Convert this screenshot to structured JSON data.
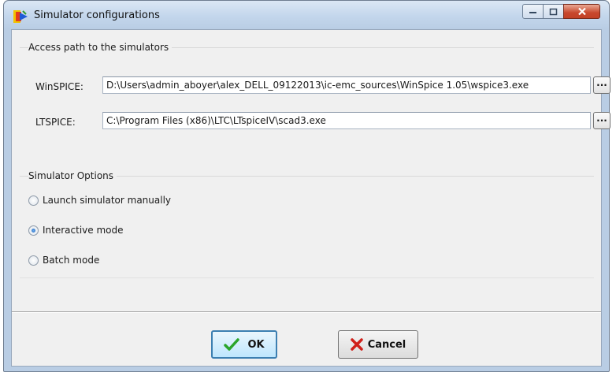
{
  "window": {
    "title": "Simulator configurations"
  },
  "access_group": {
    "legend": "Access path to the simulators",
    "winspice": {
      "label": "WinSPICE:",
      "value": "D:\\Users\\admin_aboyer\\alex_DELL_09122013\\ic-emc_sources\\WinSpice 1.05\\wspice3.exe",
      "browse_label": "..."
    },
    "ltspice": {
      "label": "LTSPICE:",
      "value": "C:\\Program Files (x86)\\LTC\\LTspiceIV\\scad3.exe",
      "browse_label": "..."
    }
  },
  "options_group": {
    "legend": "Simulator Options",
    "options": [
      {
        "label": "Launch simulator manually",
        "checked": false
      },
      {
        "label": "Interactive mode",
        "checked": true
      },
      {
        "label": "Batch mode",
        "checked": false
      }
    ]
  },
  "buttons": {
    "ok_label": "OK",
    "cancel_label": "Cancel"
  },
  "colors": {
    "ok_check": "#2aa52a",
    "cancel_x": "#d0201a",
    "close_button": "#c8482d"
  }
}
